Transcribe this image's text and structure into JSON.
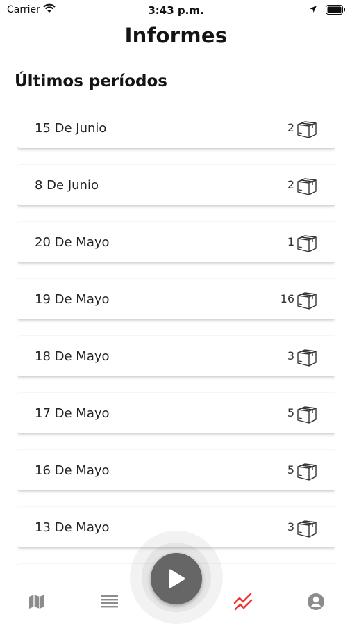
{
  "status_bar": {
    "carrier": "Carrier",
    "time": "3:43 p.m."
  },
  "header": {
    "title": "Informes"
  },
  "section": {
    "title": "Últimos períodos"
  },
  "periods": [
    {
      "date": "15 De Junio",
      "count": "2"
    },
    {
      "date": "8 De Junio",
      "count": "2"
    },
    {
      "date": "20 De Mayo",
      "count": "1"
    },
    {
      "date": "19 De Mayo",
      "count": "16"
    },
    {
      "date": "18 De Mayo",
      "count": "3"
    },
    {
      "date": "17 De Mayo",
      "count": "5"
    },
    {
      "date": "16 De Mayo",
      "count": "5"
    },
    {
      "date": "13 De Mayo",
      "count": "3"
    }
  ],
  "item_icon": "package-box-icon",
  "tab_bar": {
    "tabs": [
      {
        "icon": "map-icon",
        "active": false
      },
      {
        "icon": "list-icon",
        "active": false
      },
      {
        "icon": "reports-trend-icon",
        "active": true
      },
      {
        "icon": "profile-icon",
        "active": false
      }
    ],
    "center_action_icon": "play-icon"
  },
  "colors": {
    "active_tab": "#e53935",
    "inactive_tab": "#8c8c8c",
    "play_button": "#666666"
  }
}
